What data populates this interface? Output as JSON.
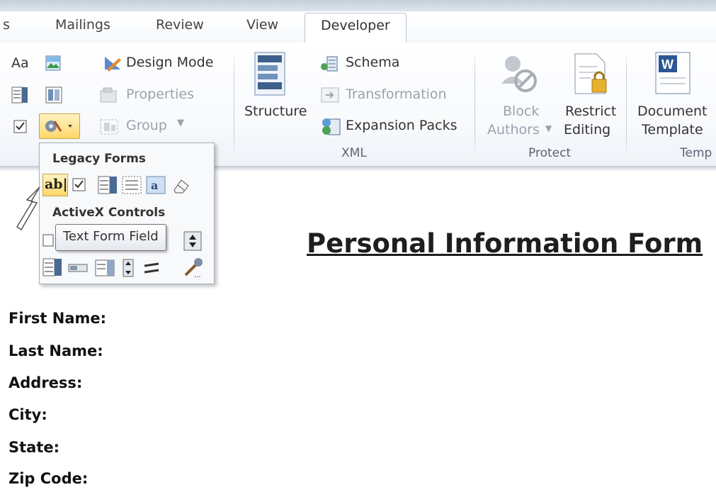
{
  "tabs": [
    "s",
    "Mailings",
    "Review",
    "View",
    "Developer"
  ],
  "active_tab": "Developer",
  "controls_group": {
    "aa_label": "Aa",
    "design_mode": "Design Mode",
    "properties": "Properties",
    "group": "Group"
  },
  "xml_group": {
    "structure": "Structure",
    "schema": "Schema",
    "transformation": "Transformation",
    "expansion_packs": "Expansion Packs",
    "label": "XML"
  },
  "protect_group": {
    "block_line1": "Block",
    "block_line2": "Authors",
    "restrict_line1": "Restrict",
    "restrict_line2": "Editing",
    "label": "Protect"
  },
  "templates_group": {
    "document_line1": "Document",
    "document_line2": "Template",
    "label": "Temp"
  },
  "legacy_popup": {
    "legacy_heading": "Legacy Forms",
    "activex_heading": "ActiveX Controls",
    "text_field_glyph": "ab|"
  },
  "tooltip": "Text Form Field",
  "document": {
    "title": "Personal Information Form",
    "fields": [
      "First Name:",
      "Last Name:",
      "Address:",
      "City:",
      "State:",
      "Zip Code:"
    ]
  }
}
